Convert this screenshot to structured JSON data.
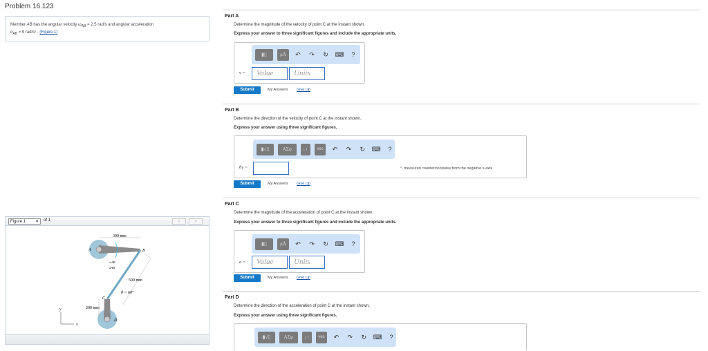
{
  "problem": {
    "title": "Problem 16.123",
    "statement_pre": "Member ",
    "member": "AB",
    "statement_mid": " has the angular velocity ω",
    "sub1": "AB",
    "statement_mid2": " = 2.5  rad/s and angular acceleration",
    "alpha": "α",
    "sub2": "AB",
    "statement_end": " = 9  rad/s²  . ",
    "figure_link": "(Figure 1)"
  },
  "figure": {
    "select": "Figure 1",
    "of": "of 1",
    "prev": "<",
    "next": ">",
    "labels": {
      "A": "A",
      "B": "B",
      "C": "C",
      "D": "D",
      "d300": "300 mm",
      "d500": "500 mm",
      "d200": "200 mm",
      "theta": "θ = 60°",
      "omega": "ωAB",
      "alpha": "αAB",
      "y": "y",
      "x": "x"
    }
  },
  "parts": [
    {
      "header": "Part A",
      "question": "Determine the magnitude of the velocity of point C at the instant shown.",
      "instruction": "Express your answer to three significant figures and include the appropriate units.",
      "var": "v =",
      "value_ph": "Value",
      "units_ph": "Units",
      "submit": "Submit",
      "my_answers": "My Answers",
      "give_up": "Give Up"
    },
    {
      "header": "Part B",
      "question": "Determine the direction of the velocity of point C at the instant shown.",
      "instruction": "Express your answer using three significant figures.",
      "var": "θv =",
      "note": "°, measured counterclockwise from the negative x-axis",
      "submit": "Submit",
      "my_answers": "My Answers",
      "give_up": "Give Up"
    },
    {
      "header": "Part C",
      "question": "Determine the magnitude of the acceleration of point C at the instant shown.",
      "instruction": "Express your answer to three significant figures and include the appropriate units.",
      "var": "a =",
      "value_ph": "Value",
      "units_ph": "Units",
      "submit": "Submit",
      "my_answers": "My Answers",
      "give_up": "Give Up"
    },
    {
      "header": "Part D",
      "question": "Determine the direction of the acceleration of point C at the instant shown.",
      "instruction": "Express your answer using three significant figures."
    }
  ],
  "toolbar": {
    "greek": "ΑΣφ",
    "units": "μÅ",
    "vec": "vec",
    "help": "?",
    "sort": "↓↑"
  }
}
